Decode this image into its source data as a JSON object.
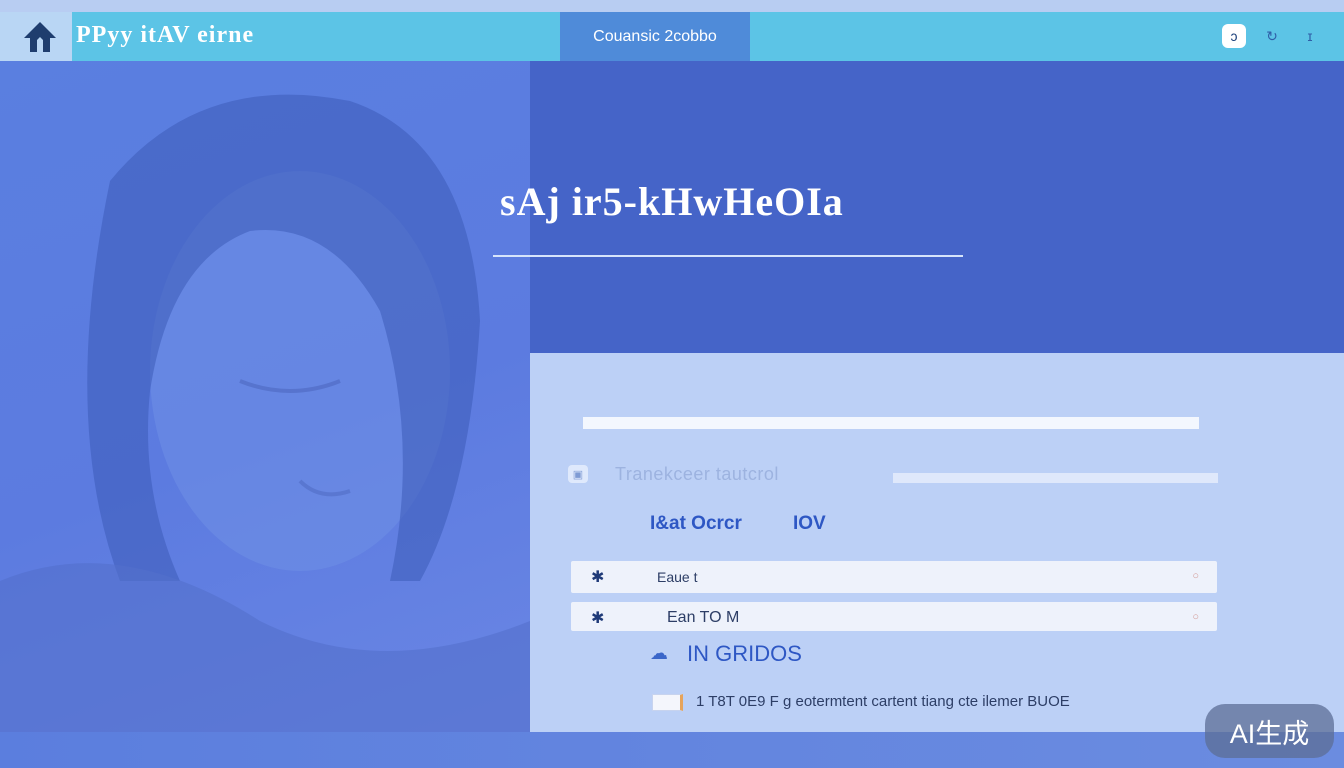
{
  "header": {
    "logo_icon": "up-arrow-logo-icon",
    "title": "PPyy itAV eirne",
    "active_tab": "Couansic 2cobbo",
    "icons": [
      "toggle-icon",
      "refresh-icon",
      "close-icon"
    ],
    "icon_glyphs": [
      "ↄ",
      "↻",
      "ɪ"
    ]
  },
  "hero": {
    "title": "sAj ir5-kHwHeOIa"
  },
  "content": {
    "subheading": "Tranekceer tautcrol",
    "link_order": "I&at Ocrcr",
    "link_iov": "IOV",
    "rows": [
      {
        "label": "Eaue t",
        "icon": "star-icon",
        "glyph": "✱"
      },
      {
        "label": "Ean TO M",
        "icon": "star-icon",
        "glyph": "✱"
      }
    ],
    "section_title": "IN GRIDOS",
    "footer_text": "1 T8T 0E9 F g eotermtent cartent tiang cte ilemer BUOE"
  },
  "badge": "AI生成",
  "colors": {
    "header_bg": "#5cc4e6",
    "active_tab_bg": "#4f8bd9",
    "hero_bg": "#4564c8",
    "content_bg": "#bcd0f6",
    "accent_text": "#2e57c4"
  }
}
